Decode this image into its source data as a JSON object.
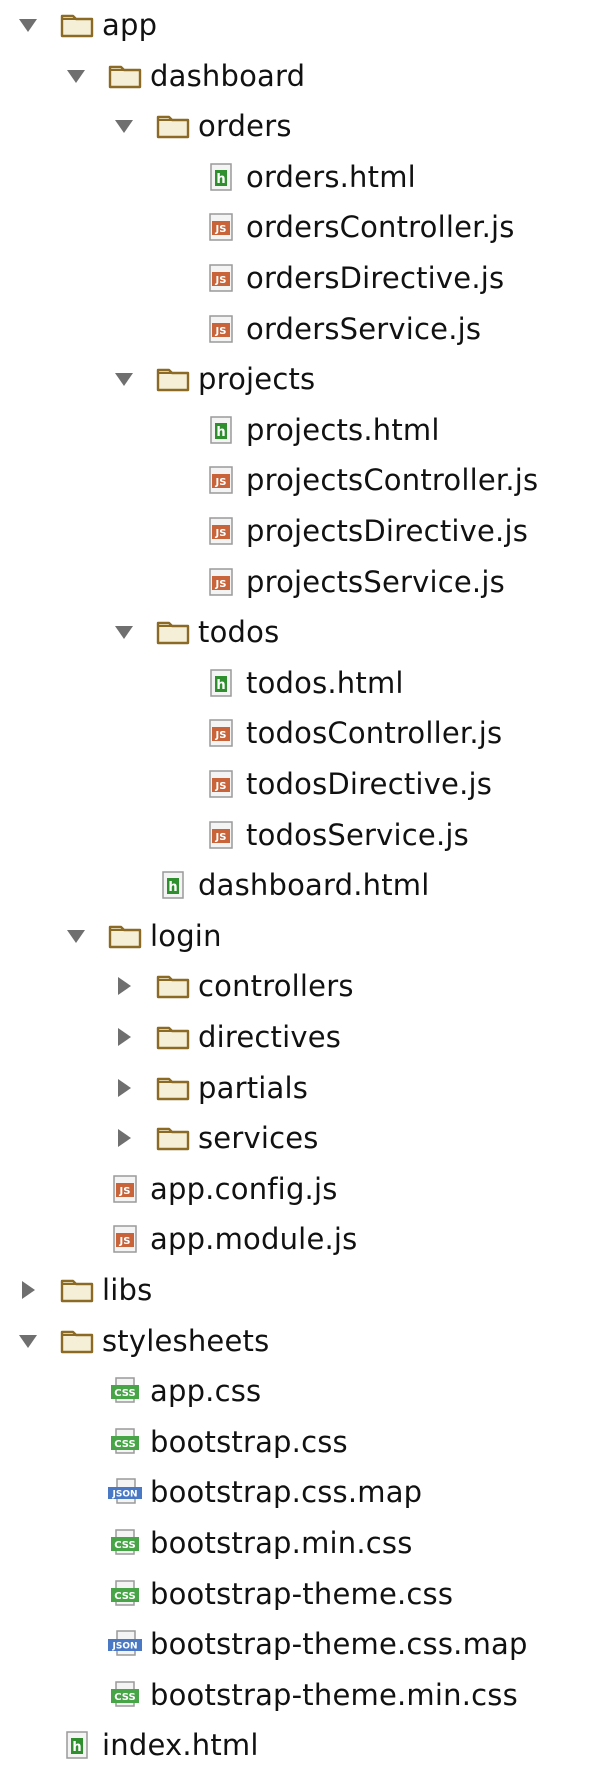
{
  "colors": {
    "folder_stroke": "#8a6a24",
    "folder_fill": "#f6efd8",
    "arrow": "#6f6f6f",
    "html_badge": "#2f8f2f",
    "js_badge": "#c9643a",
    "css_badge": "#47a447",
    "json_badge": "#4a78c4"
  },
  "tree": [
    {
      "label": "app",
      "kind": "folder",
      "depth": 0,
      "state": "expanded"
    },
    {
      "label": "dashboard",
      "kind": "folder",
      "depth": 1,
      "state": "expanded"
    },
    {
      "label": "orders",
      "kind": "folder",
      "depth": 2,
      "state": "expanded"
    },
    {
      "label": "orders.html",
      "kind": "html",
      "depth": 3
    },
    {
      "label": "ordersController.js",
      "kind": "js",
      "depth": 3
    },
    {
      "label": "ordersDirective.js",
      "kind": "js",
      "depth": 3
    },
    {
      "label": "ordersService.js",
      "kind": "js",
      "depth": 3
    },
    {
      "label": "projects",
      "kind": "folder",
      "depth": 2,
      "state": "expanded"
    },
    {
      "label": "projects.html",
      "kind": "html",
      "depth": 3
    },
    {
      "label": "projectsController.js",
      "kind": "js",
      "depth": 3
    },
    {
      "label": "projectsDirective.js",
      "kind": "js",
      "depth": 3
    },
    {
      "label": "projectsService.js",
      "kind": "js",
      "depth": 3
    },
    {
      "label": "todos",
      "kind": "folder",
      "depth": 2,
      "state": "expanded"
    },
    {
      "label": "todos.html",
      "kind": "html",
      "depth": 3
    },
    {
      "label": "todosController.js",
      "kind": "js",
      "depth": 3
    },
    {
      "label": "todosDirective.js",
      "kind": "js",
      "depth": 3
    },
    {
      "label": "todosService.js",
      "kind": "js",
      "depth": 3
    },
    {
      "label": "dashboard.html",
      "kind": "html",
      "depth": 2
    },
    {
      "label": "login",
      "kind": "folder",
      "depth": 1,
      "state": "expanded"
    },
    {
      "label": "controllers",
      "kind": "folder",
      "depth": 2,
      "state": "collapsed"
    },
    {
      "label": "directives",
      "kind": "folder",
      "depth": 2,
      "state": "collapsed"
    },
    {
      "label": "partials",
      "kind": "folder",
      "depth": 2,
      "state": "collapsed"
    },
    {
      "label": "services",
      "kind": "folder",
      "depth": 2,
      "state": "collapsed"
    },
    {
      "label": "app.config.js",
      "kind": "js",
      "depth": 1
    },
    {
      "label": "app.module.js",
      "kind": "js",
      "depth": 1
    },
    {
      "label": "libs",
      "kind": "folder",
      "depth": 0,
      "state": "collapsed"
    },
    {
      "label": "stylesheets",
      "kind": "folder",
      "depth": 0,
      "state": "expanded"
    },
    {
      "label": "app.css",
      "kind": "css",
      "depth": 1
    },
    {
      "label": "bootstrap.css",
      "kind": "css",
      "depth": 1
    },
    {
      "label": "bootstrap.css.map",
      "kind": "json",
      "depth": 1
    },
    {
      "label": "bootstrap.min.css",
      "kind": "css",
      "depth": 1
    },
    {
      "label": "bootstrap-theme.css",
      "kind": "css",
      "depth": 1
    },
    {
      "label": "bootstrap-theme.css.map",
      "kind": "json",
      "depth": 1
    },
    {
      "label": "bootstrap-theme.min.css",
      "kind": "css",
      "depth": 1
    },
    {
      "label": "index.html",
      "kind": "html",
      "depth": 0
    }
  ]
}
